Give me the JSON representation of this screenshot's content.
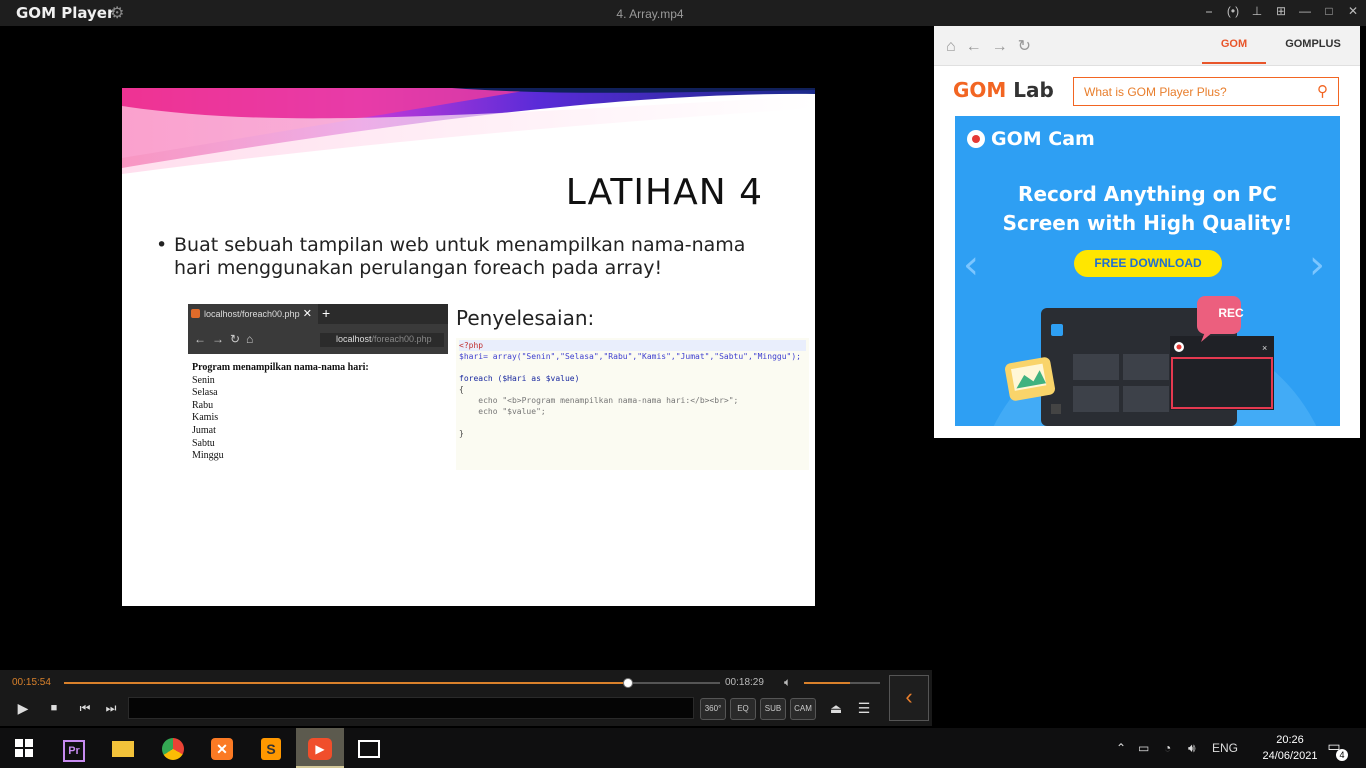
{
  "window": {
    "app_name": "GOM Player",
    "title": "4. Array.mp4",
    "controls": [
      "⎯",
      "(•)",
      "⊥",
      "⊞",
      "—",
      "□",
      "✕"
    ]
  },
  "slide": {
    "title": "LATIHAN 4",
    "bullet": "Buat sebuah tampilan web untuk menampilkan nama-nama hari menggunakan perulangan foreach pada array!",
    "browser_tab": "localhost/foreach00.php",
    "browser_url_host": "localhost",
    "browser_url_path": "/foreach00.php",
    "output_heading": "Program menampilkan nama-nama hari:",
    "output_days": [
      "Senin",
      "Selasa",
      "Rabu",
      "Kamis",
      "Jumat",
      "Sabtu",
      "Minggu"
    ],
    "solution_label": "Penyelesaian:",
    "code_lines": [
      "<?php",
      "$hari= array(\"Senin\",\"Selasa\",\"Rabu\",\"Kamis\",\"Jumat\",\"Sabtu\",\"Minggu\");",
      "",
      "foreach ($Hari as $value)",
      "{",
      "    echo \"<b>Program menampilkan nama-nama hari:</b><br>\";",
      "    echo \"$value\";",
      "",
      "}"
    ]
  },
  "player": {
    "current_time": "00:15:54",
    "total_time": "00:18:29",
    "progress": 0.86,
    "volume": 0.6,
    "buttons": {
      "play": "▶",
      "stop": "■",
      "prev": "⏮",
      "next": "⏭",
      "eject": "⏏",
      "menu": "☰",
      "collapse": "‹"
    },
    "mini_buttons": [
      "360°",
      "EQ",
      "SUB",
      "CAM"
    ]
  },
  "sidepanel": {
    "tab_gom": "GOM",
    "tab_gomplus": "GOMPLUS",
    "logo_gom": "GOM",
    "logo_lab": "Lab",
    "search_placeholder": "What is GOM Player Plus?",
    "banner_brand": "GOM Cam",
    "banner_headline_1": "Record Anything on PC",
    "banner_headline_2": "Screen with High Quality!",
    "banner_button": "FREE DOWNLOAD",
    "rec_label": "REC"
  },
  "taskbar": {
    "language": "ENG",
    "time": "20:26",
    "date": "24/06/2021",
    "notifications": "4",
    "apps": [
      "start",
      "premiere",
      "file-explorer",
      "chrome",
      "xampp",
      "sublime-text",
      "gom-player",
      "photos"
    ]
  },
  "colors": {
    "accent": "#d9812b",
    "gom_orange": "#f26522",
    "banner_blue": "#2e9ff3",
    "download_yellow": "#ffe600"
  }
}
